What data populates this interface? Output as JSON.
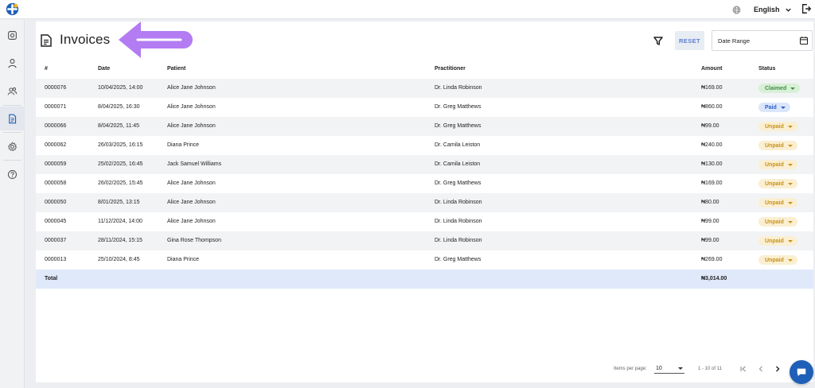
{
  "header": {
    "language": "English"
  },
  "page": {
    "title": "Invoices"
  },
  "toolbar": {
    "reset_label": "RESET",
    "date_range_placeholder": "Date Range"
  },
  "table": {
    "headers": {
      "num": "#",
      "date": "Date",
      "patient": "Patient",
      "practitioner": "Practitioner",
      "amount": "Amount",
      "status": "Status"
    },
    "rows": [
      {
        "num": "0000076",
        "date": "10/04/2025, 14:00",
        "patient": "Alice Jane Johnson",
        "practitioner": "Dr. Linda Robinson",
        "amount": "₦169.00",
        "status": "Claimed",
        "status_type": "claimed"
      },
      {
        "num": "0000071",
        "date": "8/04/2025, 16:30",
        "patient": "Alice Jane Johnson",
        "practitioner": "Dr. Greg Matthews",
        "amount": "₦860.00",
        "status": "Paid",
        "status_type": "paid"
      },
      {
        "num": "0000066",
        "date": "8/04/2025, 11:45",
        "patient": "Alice Jane Johnson",
        "practitioner": "Dr. Greg Matthews",
        "amount": "₦99.00",
        "status": "Unpaid",
        "status_type": "unpaid"
      },
      {
        "num": "0000062",
        "date": "26/03/2025, 16:15",
        "patient": "Diana Prince",
        "practitioner": "Dr. Camila Leiston",
        "amount": "₦240.00",
        "status": "Unpaid",
        "status_type": "unpaid"
      },
      {
        "num": "0000059",
        "date": "25/02/2025, 16:45",
        "patient": "Jack Samuel Williams",
        "practitioner": "Dr. Camila Leiston",
        "amount": "₦130.00",
        "status": "Unpaid",
        "status_type": "unpaid"
      },
      {
        "num": "0000058",
        "date": "26/02/2025, 15:45",
        "patient": "Alice Jane Johnson",
        "practitioner": "Dr. Greg Matthews",
        "amount": "₦169.00",
        "status": "Unpaid",
        "status_type": "unpaid"
      },
      {
        "num": "0000050",
        "date": "8/01/2025, 13:15",
        "patient": "Alice Jane Johnson",
        "practitioner": "Dr. Linda Robinson",
        "amount": "₦80.00",
        "status": "Unpaid",
        "status_type": "unpaid"
      },
      {
        "num": "0000045",
        "date": "11/12/2024, 14:00",
        "patient": "Alice Jane Johnson",
        "practitioner": "Dr. Linda Robinson",
        "amount": "₦99.00",
        "status": "Unpaid",
        "status_type": "unpaid"
      },
      {
        "num": "0000037",
        "date": "28/11/2024, 15:15",
        "patient": "Gina Rose Thompson",
        "practitioner": "Dr. Linda Robinson",
        "amount": "₦99.00",
        "status": "Unpaid",
        "status_type": "unpaid"
      },
      {
        "num": "0000013",
        "date": "25/10/2024, 8:45",
        "patient": "Diana Prince",
        "practitioner": "Dr. Greg Matthews",
        "amount": "₦269.00",
        "status": "Unpaid",
        "status_type": "unpaid"
      }
    ],
    "total": {
      "label": "Total",
      "amount": "₦3,014.00"
    }
  },
  "pagination": {
    "items_per_page_label": "Items per page:",
    "items_per_page_value": "10",
    "range_label": "1 - 10 of 11"
  },
  "icons": {
    "sidebar": [
      "dashboard-icon",
      "user-icon",
      "users-icon",
      "invoice-icon",
      "settings-icon",
      "help-icon"
    ]
  },
  "colors": {
    "accent": "#1e5fb8",
    "arrow": "#b37cf2",
    "claimed_bg": "#d8f0d6",
    "paid_bg": "#dbe6fb",
    "unpaid_bg": "#fbefd2",
    "total_row_bg": "#dfe9fa"
  }
}
